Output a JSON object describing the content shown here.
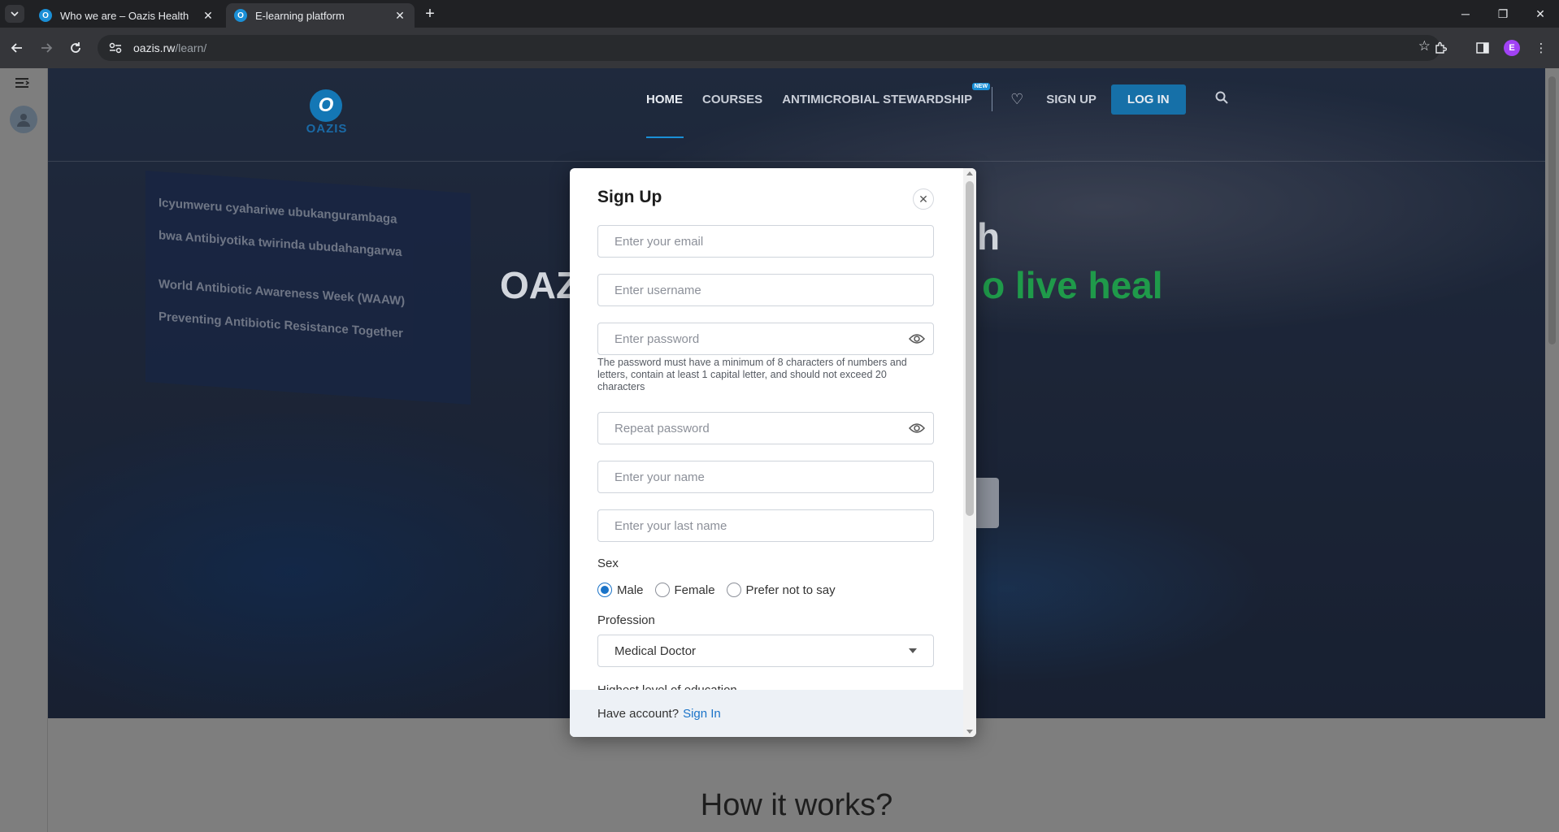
{
  "browser": {
    "tabs": [
      {
        "title": "Who we are – Oazis Health",
        "active": false
      },
      {
        "title": "E-learning platform",
        "active": true
      }
    ],
    "url_host": "oazis.rw",
    "url_path": "/learn/",
    "profile_initial": "E"
  },
  "site": {
    "logo_text": "OAZIS",
    "nav": {
      "home": "HOME",
      "courses": "COURSES",
      "stewardship": "ANTIMICROBIAL STEWARDSHIP",
      "new_badge": "NEW",
      "signup": "SIGN UP",
      "login": "LOG IN"
    },
    "hero": {
      "title_left": "OAZ",
      "title_right_fragment": "h",
      "accent_fragment": "o live heal",
      "banner_lines": [
        "Icyumweru cyahariwe ubukangurambaga",
        "bwa Antibiyotika twirinda ubudahangarwa",
        "World Antibiotic Awareness Week (WAAW)",
        "Preventing Antibiotic Resistance Together"
      ]
    },
    "how_it_works": "How it works?"
  },
  "signup_modal": {
    "title": "Sign Up",
    "fields": {
      "email_placeholder": "Enter your email",
      "username_placeholder": "Enter username",
      "password_placeholder": "Enter password",
      "repeat_password_placeholder": "Repeat password",
      "name_placeholder": "Enter your name",
      "last_name_placeholder": "Enter your last name"
    },
    "password_hint": "The password must have a minimum of 8 characters of numbers and letters, contain at least 1 capital letter, and should not exceed 20 characters",
    "sex_label": "Sex",
    "sex_options": [
      "Male",
      "Female",
      "Prefer not to say"
    ],
    "sex_selected": "Male",
    "profession_label": "Profession",
    "profession_value": "Medical Doctor",
    "next_label_partial": "Highest level of education",
    "footer_text": "Have account?",
    "footer_link": "Sign In"
  },
  "colors": {
    "accent_blue": "#1a73c8",
    "accent_green": "#1f9a4a",
    "login_button": "#1670a8"
  }
}
